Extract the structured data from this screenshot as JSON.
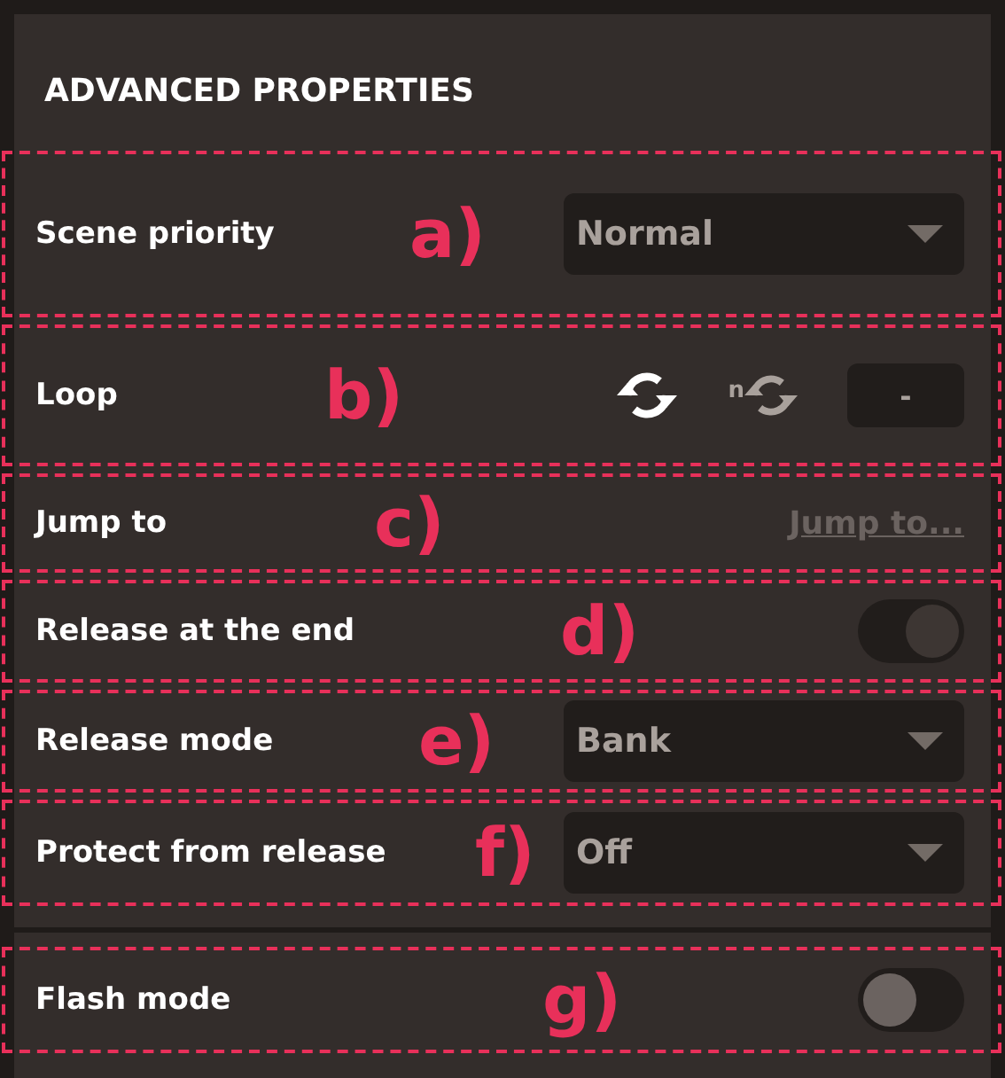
{
  "title": "ADVANCED PROPERTIES",
  "sections": [
    {
      "rows": [
        {
          "kind": "dropdown",
          "label": "Scene priority",
          "marker": "a)",
          "value": "Normal"
        },
        {
          "kind": "loop",
          "label": "Loop",
          "marker": "b)",
          "count_badge": "n",
          "count": "-"
        },
        {
          "kind": "link",
          "label": "Jump to",
          "marker": "c)",
          "link": "Jump to..."
        },
        {
          "kind": "toggle",
          "label": "Release at the end",
          "marker": "d)",
          "on": true
        },
        {
          "kind": "dropdown",
          "label": "Release mode",
          "marker": "e)",
          "value": "Bank"
        },
        {
          "kind": "dropdown",
          "label": "Protect from release",
          "marker": "f)",
          "value": "Off"
        }
      ]
    },
    {
      "rows": [
        {
          "kind": "toggle",
          "label": "Flash mode",
          "marker": "g)",
          "on": false
        }
      ]
    }
  ]
}
